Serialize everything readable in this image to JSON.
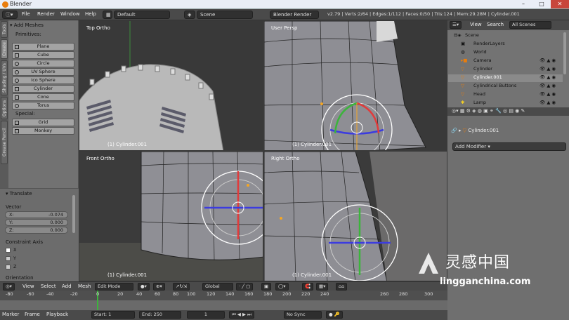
{
  "titlebar": {
    "title": "Blender"
  },
  "menu": {
    "file": "File",
    "render": "Render",
    "window": "Window",
    "help": "Help"
  },
  "header": {
    "layout": "Default",
    "scene": "Scene",
    "engine": "Blender Render",
    "stats": "v2.79 | Verts:2/64 | Edges:1/112 | Faces:0/50 | Tris:124 | Mem:29.28M | Cylinder.001"
  },
  "vtabs": [
    "Tools",
    "Create",
    "Shading / UVs",
    "Options",
    "Grease Pencil"
  ],
  "toolshelf": {
    "panel_title": "Add Meshes",
    "primitives_label": "Primitives:",
    "primitives": [
      "Plane",
      "Cube",
      "Circle",
      "UV Sphere",
      "Ico Sphere",
      "Cylinder",
      "Cone",
      "Torus"
    ],
    "special_label": "Special:",
    "special": [
      "Grid",
      "Monkey"
    ]
  },
  "operator": {
    "title": "Translate",
    "vector_label": "Vector",
    "x_label": "X:",
    "x_value": "-0.074",
    "y_label": "Y:",
    "y_value": "0.000",
    "z_label": "Z:",
    "z_value": "0.000",
    "constraint_label": "Constraint Axis",
    "axes": [
      "X",
      "Y",
      "Z"
    ],
    "orientation_label": "Orientation"
  },
  "viewports": [
    {
      "label": "Top Ortho",
      "object": "(1) Cylinder.001"
    },
    {
      "label": "User Persp",
      "object": "(1) Cylinder.001"
    },
    {
      "label": "Front Ortho",
      "object": "(1) Cylinder.001"
    },
    {
      "label": "Right Ortho",
      "object": "(1) Cylinder.001"
    }
  ],
  "viewheader": {
    "view": "View",
    "select": "Select",
    "add": "Add",
    "mesh": "Mesh",
    "mode": "Edit Mode",
    "orientation": "Global"
  },
  "timeline": {
    "ticks": [
      "-80",
      "-60",
      "-40",
      "-20",
      "0",
      "20",
      "40",
      "60",
      "80",
      "100",
      "120",
      "140",
      "160",
      "180",
      "200",
      "220",
      "240",
      "260",
      "280",
      "300"
    ],
    "marker": "Marker",
    "frame": "Frame",
    "playback": "Playback",
    "start": "Start:",
    "start_val": "1",
    "end": "End:",
    "end_val": "250",
    "current": "1",
    "sync": "No Sync"
  },
  "outliner": {
    "view": "View",
    "search": "Search",
    "filter": "All Scenes",
    "items": [
      "Scene",
      "RenderLayers",
      "World",
      "Camera",
      "Cylinder",
      "Cylinder.001",
      "Cylindrical Buttons",
      "Head",
      "Lamp"
    ]
  },
  "properties": {
    "object": "Cylinder.001",
    "add_modifier": "Add Modifier"
  },
  "watermark": {
    "cn": "灵感中国",
    "url": "lingganchina.com"
  },
  "colors": {
    "accent": "#e87d0d",
    "selected": "#f5a623",
    "x_axis": "#e03c3c",
    "y_axis": "#3cb43c",
    "z_axis": "#3c3ce0"
  }
}
